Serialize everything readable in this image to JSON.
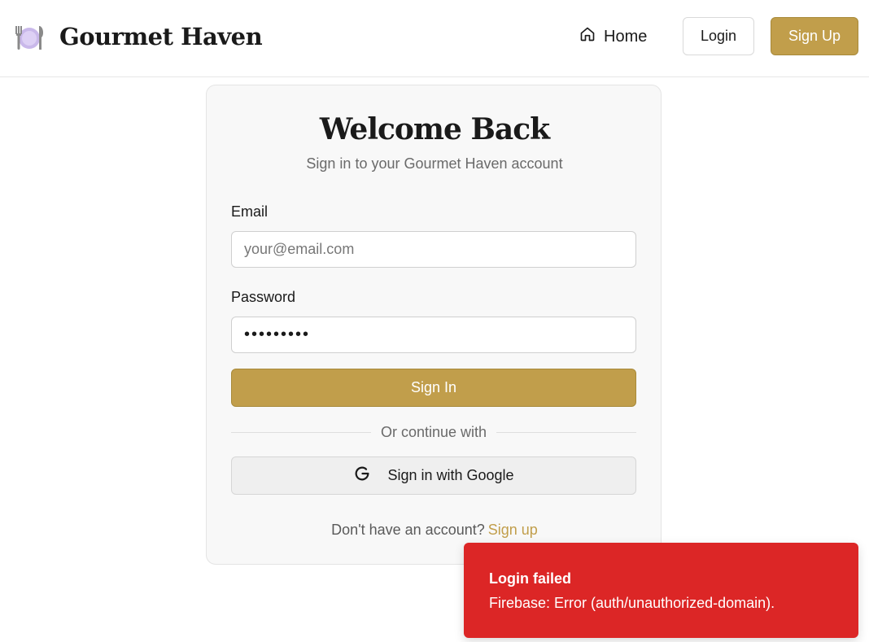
{
  "header": {
    "brand": "Gourmet Haven",
    "brand_icon": "plate-cutlery-icon",
    "nav": {
      "home_label": "Home",
      "home_icon": "home-icon",
      "login_label": "Login",
      "signup_label": "Sign Up"
    }
  },
  "login_card": {
    "title": "Welcome Back",
    "subtitle": "Sign in to your Gourmet Haven account",
    "email": {
      "label": "Email",
      "placeholder": "your@email.com",
      "value": ""
    },
    "password": {
      "label": "Password",
      "value": "•••••••••"
    },
    "signin_label": "Sign In",
    "divider_text": "Or continue with",
    "google_label": "Sign in with Google",
    "google_icon": "google-g-icon",
    "no_account_text": "Don't have an account?",
    "signup_link": "Sign up"
  },
  "toast": {
    "title": "Login failed",
    "message": "Firebase: Error (auth/unauthorized-domain)."
  },
  "colors": {
    "accent": "#c19e4b",
    "error": "#dc2626",
    "card_bg": "#f8f8f8"
  }
}
